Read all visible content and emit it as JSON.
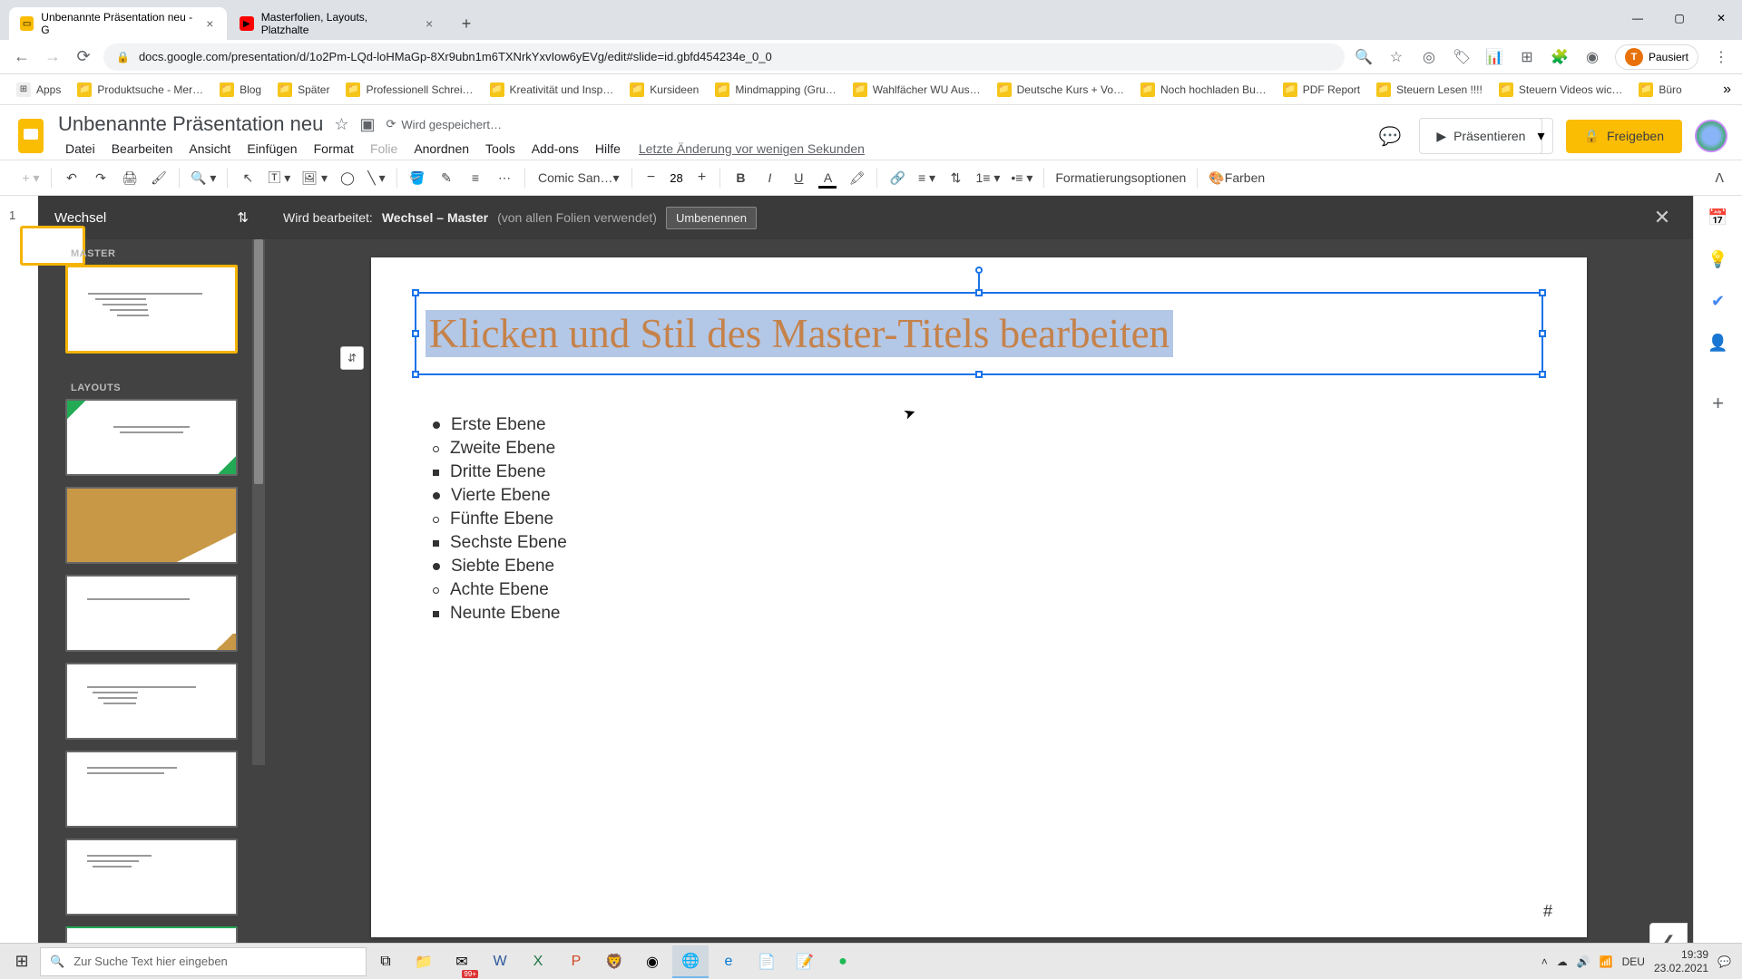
{
  "browser": {
    "tabs": [
      {
        "title": "Unbenannte Präsentation neu - G",
        "favicon": "slides"
      },
      {
        "title": "Masterfolien, Layouts, Platzhalte",
        "favicon": "youtube"
      }
    ],
    "url": "docs.google.com/presentation/d/1o2Pm-LQd-loHMaGp-8Xr9ubn1m6TXNrkYxvIow6yEVg/edit#slide=id.gbfd454234e_0_0",
    "paused": "Pausiert",
    "bookmarks": [
      "Apps",
      "Produktsuche - Mer…",
      "Blog",
      "Später",
      "Professionell Schrei…",
      "Kreativität und Insp…",
      "Kursideen",
      "Mindmapping  (Gru…",
      "Wahlfächer WU Aus…",
      "Deutsche Kurs + Vo…",
      "Noch hochladen Bu…",
      "PDF Report",
      "Steuern Lesen !!!!",
      "Steuern Videos wic…",
      "Büro"
    ]
  },
  "slides": {
    "docTitle": "Unbenannte Präsentation neu",
    "saving": "Wird gespeichert…",
    "menus": [
      "Datei",
      "Bearbeiten",
      "Ansicht",
      "Einfügen",
      "Format",
      "Folie",
      "Anordnen",
      "Tools",
      "Add-ons",
      "Hilfe"
    ],
    "lastEdit": "Letzte Änderung vor wenigen Sekunden",
    "presentBtn": "Präsentieren",
    "shareBtn": "Freigeben",
    "toolbar": {
      "fontName": "Comic San…",
      "fontSize": "28",
      "formatOptions": "Formatierungsoptionen",
      "colors": "Farben"
    },
    "master": {
      "themeName": "Wechsel",
      "sectionMaster": "MASTER",
      "sectionLayouts": "LAYOUTS",
      "infoPrefix": "Wird bearbeitet:",
      "infoName": "Wechsel – Master",
      "infoUsage": "(von allen Folien verwendet)",
      "rename": "Umbenennen"
    },
    "slideContent": {
      "title": "Klicken und Stil des Master-Titels bearbeiten",
      "levels": [
        "Erste Ebene",
        "Zweite Ebene",
        "Dritte Ebene",
        "Vierte Ebene",
        "Fünfte Ebene",
        "Sechste Ebene",
        "Siebte Ebene",
        "Achte Ebene",
        "Neunte Ebene"
      ],
      "pageNum": "#"
    },
    "slideFilmstripNumber": "1"
  },
  "taskbar": {
    "searchPlaceholder": "Zur Suche Text hier eingeben",
    "badge": "99+",
    "lang": "DEU",
    "time": "19:39",
    "date": "23.02.2021"
  }
}
